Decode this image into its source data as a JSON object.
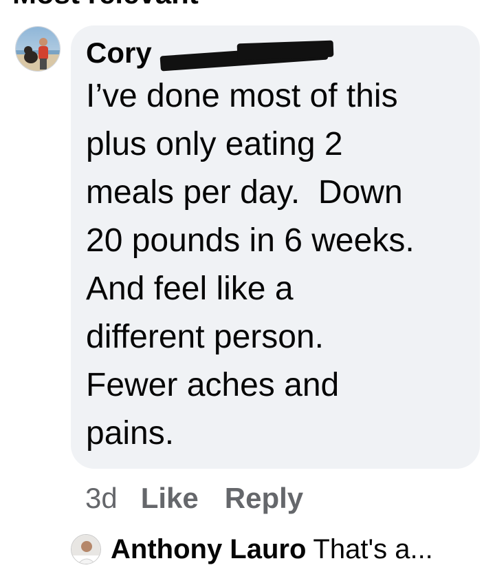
{
  "section_header": "Most relevant",
  "comment": {
    "author": "Cory",
    "author_redacted": true,
    "lines": [
      "I’ve done most of this",
      "plus only eating 2",
      "meals per day.  Down",
      "20 pounds in 6 weeks.",
      "And feel like a",
      "different person.",
      "Fewer aches and",
      "pains."
    ],
    "timestamp": "3d",
    "like_label": "Like",
    "reply_label": "Reply"
  },
  "reply_preview": {
    "author": "Anthony Lauro",
    "snippet": "That's a..."
  },
  "colors": {
    "bubble_bg": "#f0f2f5",
    "text": "#050505",
    "secondary_text": "#65676b"
  }
}
